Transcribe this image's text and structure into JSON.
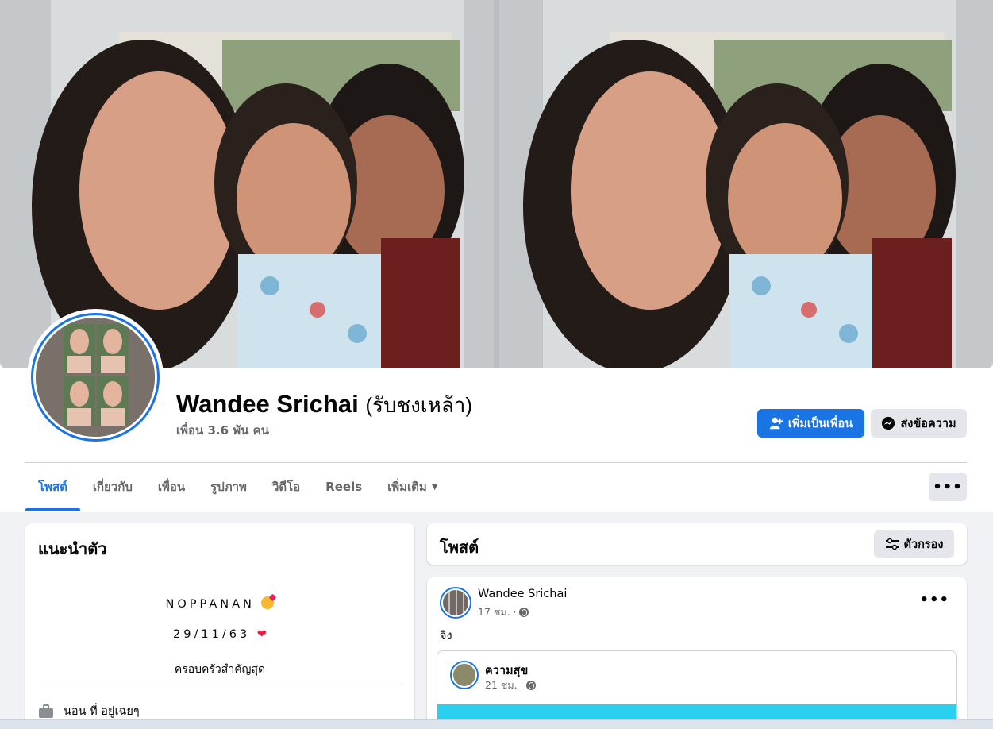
{
  "profile": {
    "name": "Wandee Srichai",
    "alt_name": "(รับชงเหล้า)",
    "friends": "เพื่อน 3.6 พัน คน",
    "add_friend_label": "เพิ่มเป็นเพื่อน",
    "message_label": "ส่งข้อความ"
  },
  "tabs": [
    {
      "label": "โพสต์",
      "active": true
    },
    {
      "label": "เกี่ยวกับ",
      "active": false
    },
    {
      "label": "เพื่อน",
      "active": false
    },
    {
      "label": "รูปภาพ",
      "active": false
    },
    {
      "label": "วิดีโอ",
      "active": false
    },
    {
      "label": "Reels",
      "active": false
    },
    {
      "label": "เพิ่มเติม",
      "active": false
    }
  ],
  "more_label": "•••",
  "intro": {
    "title": "แนะนำตัว",
    "bio_line1": "NOPPANAN",
    "bio_line2": "29/11/63",
    "bio_line3": "ครอบครัวสำคัญสุด",
    "detail": "นอน ที่ อยู่เฉยๆ"
  },
  "posts_header": {
    "title": "โพสต์",
    "filter_label": "ตัวกรอง"
  },
  "post": {
    "author": "Wandee Srichai",
    "time": "17 ชม. ·",
    "text": "จิง",
    "more": "•••",
    "shared": {
      "author": "ความสุข",
      "time": "21 ชม. ·"
    }
  },
  "colors": {
    "accent": "#1b74e4",
    "background": "#f0f2f5",
    "secondary_button": "#e4e6eb",
    "shared_band": "#29d0ef"
  },
  "icons": [
    "add-friend-icon",
    "messenger-icon",
    "chevron-down-icon",
    "filter-icon",
    "globe-icon",
    "briefcase-icon"
  ]
}
